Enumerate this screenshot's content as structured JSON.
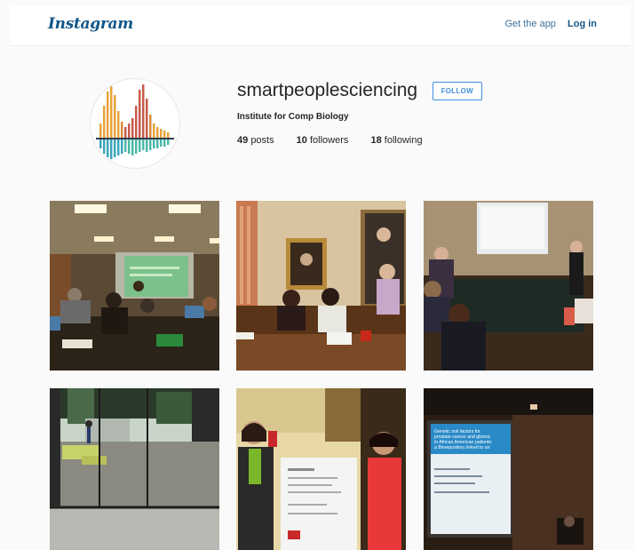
{
  "header": {
    "logo": "Instagram",
    "get_app_label": "Get the app",
    "login_label": "Log in"
  },
  "profile": {
    "username": "smartpeoplesciencing",
    "follow_label": "FOLLOW",
    "full_name": "Institute for Comp Biology",
    "stats": {
      "posts_count": "49",
      "posts_label": "posts",
      "followers_count": "10",
      "followers_label": "followers",
      "following_count": "18",
      "following_label": "following"
    }
  },
  "posts": {
    "post_6": {
      "slide_text": "Genetic risk factors for prostate cancer and glioma in African American patients: a Biorepository linked to an electronic medical record",
      "slide_sub": "Sarah Thompson, PhD"
    }
  },
  "colors": {
    "brand": "#125688",
    "link": "#3f729b",
    "follow_button": "#4090db",
    "background": "#fafafa"
  }
}
